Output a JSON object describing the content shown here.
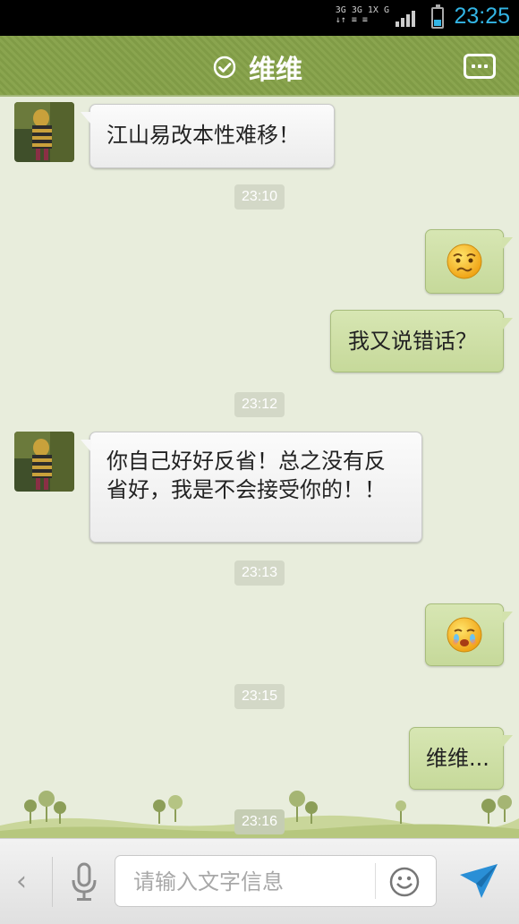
{
  "status_bar": {
    "network_top": "3G 3G 1X  G",
    "network_bottom": "↓↑  ≡  ≡",
    "time": "23:25",
    "battery_level": 0.4
  },
  "header": {
    "title": "维维",
    "title_icon": "check-circle-icon",
    "menu_icon": "more-icon"
  },
  "messages": [
    {
      "side": "in",
      "type": "text",
      "text": "江山易改本性难移！"
    },
    {
      "type": "time",
      "text": "23:10"
    },
    {
      "side": "out",
      "type": "emoji",
      "emoji": "worried-face-emoji"
    },
    {
      "side": "out",
      "type": "text",
      "text": "我又说错话？"
    },
    {
      "type": "time",
      "text": "23:12"
    },
    {
      "side": "in",
      "type": "text",
      "text": "你自己好好反省！总之没有反省好，我是不会接受你的！！"
    },
    {
      "type": "time",
      "text": "23:13"
    },
    {
      "side": "out",
      "type": "emoji",
      "emoji": "crying-face-emoji"
    },
    {
      "type": "time",
      "text": "23:15"
    },
    {
      "side": "out",
      "type": "text",
      "text": "维维..."
    },
    {
      "type": "time",
      "text": "23:16"
    }
  ],
  "input_bar": {
    "back_label": "‹",
    "placeholder": "请输入文字信息",
    "voice_icon": "microphone-icon",
    "emoji_icon": "smiley-icon",
    "send_icon": "send-icon"
  },
  "colors": {
    "header": "#8aa54f",
    "chat_bg": "#e8eddc",
    "outgoing_bubble": "#cfdfa6",
    "incoming_bubble": "#f6f6f6",
    "time_accent": "#33b5e5"
  }
}
